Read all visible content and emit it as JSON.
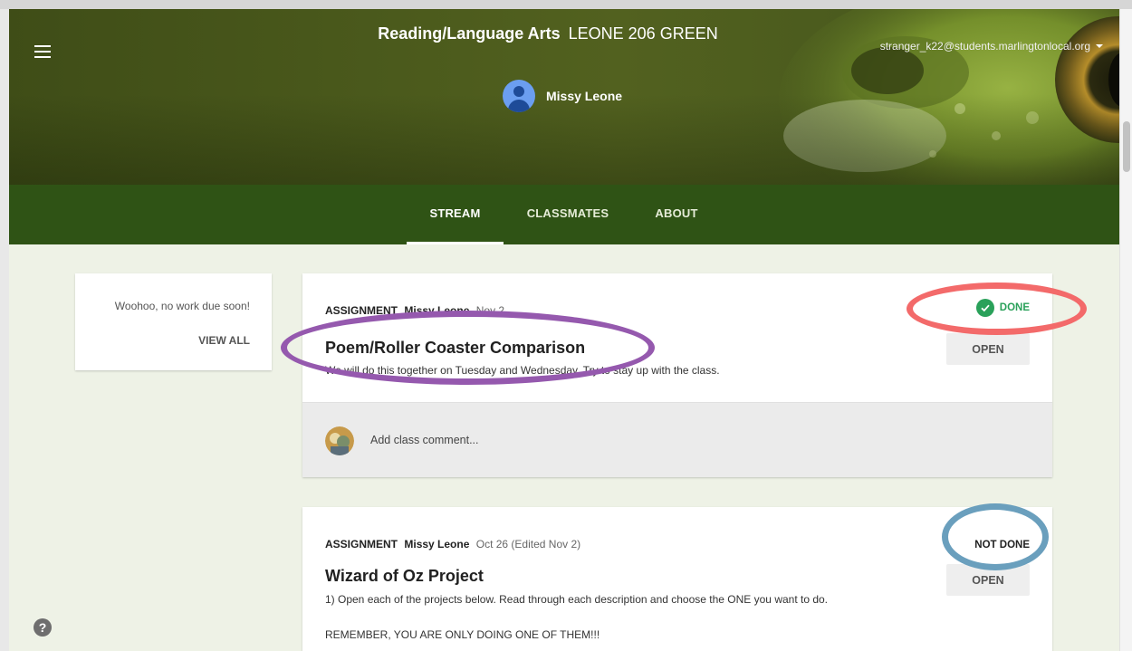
{
  "header": {
    "course_name": "Reading/Language Arts",
    "section": "LEONE 206 GREEN",
    "teacher_name": "Missy Leone",
    "account_email": "stranger_k22@students.marlingtonlocal.org"
  },
  "tabs": [
    {
      "label": "STREAM",
      "active": true
    },
    {
      "label": "CLASSMATES",
      "active": false
    },
    {
      "label": "ABOUT",
      "active": false
    }
  ],
  "upcoming": {
    "message": "Woohoo, no work due soon!",
    "view_all_label": "VIEW ALL"
  },
  "assignments": [
    {
      "kind": "ASSIGNMENT",
      "author": "Missy Leone",
      "date": "Nov 2",
      "title": "Poem/Roller Coaster Comparison",
      "description": "We will do this together on Tuesday and Wednesday. Try to stay up with the class.",
      "status": "DONE",
      "open_label": "OPEN",
      "comment_placeholder": "Add class comment..."
    },
    {
      "kind": "ASSIGNMENT",
      "author": "Missy Leone",
      "date": "Oct 26 (Edited Nov 2)",
      "title": "Wizard of Oz Project",
      "description": "1) Open each of the projects below. Read through each description and choose the ONE you want to do.",
      "description2": "REMEMBER, YOU ARE ONLY DOING ONE OF THEM!!!",
      "status": "NOT DONE",
      "open_label": "OPEN"
    }
  ],
  "help_label": "?",
  "icons": [
    "menu-icon",
    "check-circle-icon",
    "help-icon",
    "account-caret-icon"
  ],
  "colors": {
    "tab_bar": "#2f5315",
    "page_bg": "#eef2e6",
    "done_green": "#2aa15a",
    "annotation_purple": "#9559ae",
    "annotation_red": "#f36a6a",
    "annotation_blue": "#6a9fbd"
  }
}
